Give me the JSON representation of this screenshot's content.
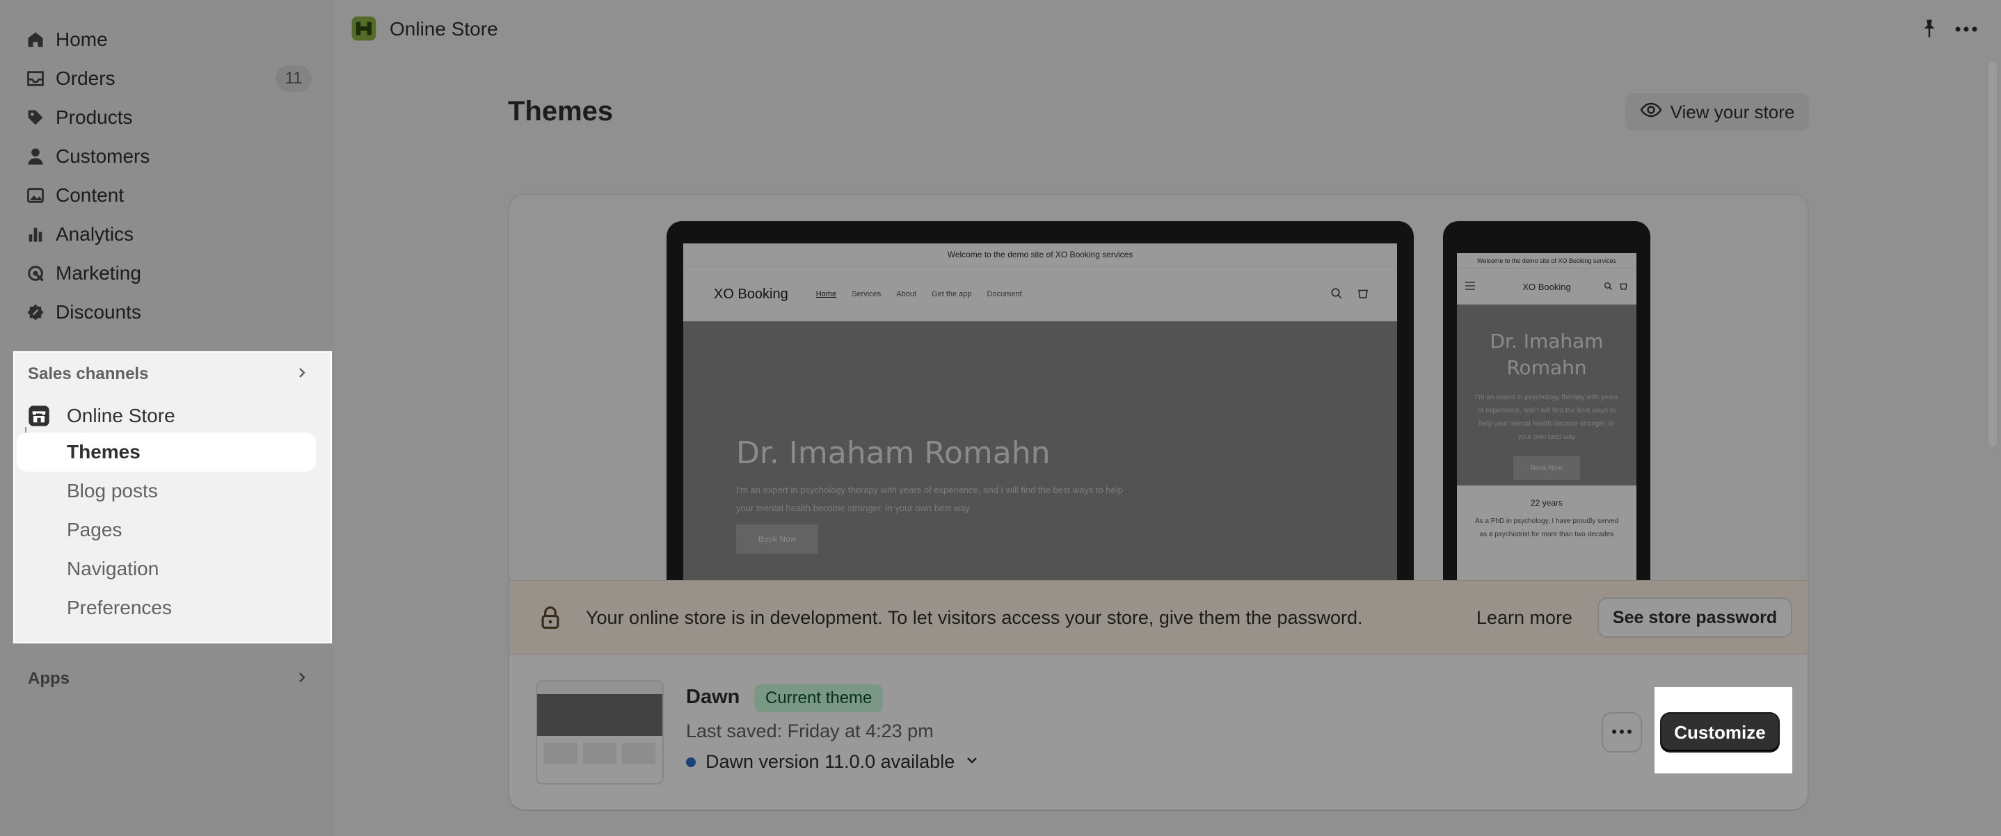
{
  "sidebar": {
    "items": [
      {
        "label": "Home",
        "icon": "home-icon"
      },
      {
        "label": "Orders",
        "icon": "inbox-icon",
        "badge": "11"
      },
      {
        "label": "Products",
        "icon": "tag-icon"
      },
      {
        "label": "Customers",
        "icon": "person-icon"
      },
      {
        "label": "Content",
        "icon": "image-icon"
      },
      {
        "label": "Analytics",
        "icon": "bar-chart-icon"
      },
      {
        "label": "Marketing",
        "icon": "target-icon"
      },
      {
        "label": "Discounts",
        "icon": "discount-icon"
      }
    ],
    "sales_channels": {
      "heading": "Sales channels",
      "online_store": "Online Store",
      "sub_items": [
        "Themes",
        "Blog posts",
        "Pages",
        "Navigation",
        "Preferences"
      ],
      "active": "Themes"
    },
    "apps_heading": "Apps"
  },
  "topbar": {
    "title": "Online Store"
  },
  "page": {
    "title": "Themes",
    "view_store": "View your store"
  },
  "preview": {
    "announcement": "Welcome to the demo site of XO Booking services",
    "logo": "XO Booking",
    "nav": [
      "Home",
      "Services",
      "About",
      "Get the app",
      "Document"
    ],
    "hero_title": "Dr. Imaham Romahn",
    "hero_text": "I'm an expert in psychology therapy with years of experience, and I will find the best ways to help your mental health become stronger, in your own best way",
    "hero_button": "Book Now",
    "mobile_stat": "22 years",
    "mobile_stat_text": "As a PhD in psychology, I have proudly served as a psychiatrist for more than two decades"
  },
  "banner": {
    "text": "Your online store is in development. To let visitors access your store, give them the password.",
    "learn_more": "Learn more",
    "see_password": "See store password"
  },
  "theme": {
    "name": "Dawn",
    "badge": "Current theme",
    "last_saved": "Last saved: Friday at 4:23 pm",
    "version": "Dawn version 11.0.0 available",
    "customize": "Customize"
  },
  "colors": {
    "accent_dark": "#303030",
    "badge_green": "#cdfee1",
    "banner_bg": "#fff4e6"
  }
}
